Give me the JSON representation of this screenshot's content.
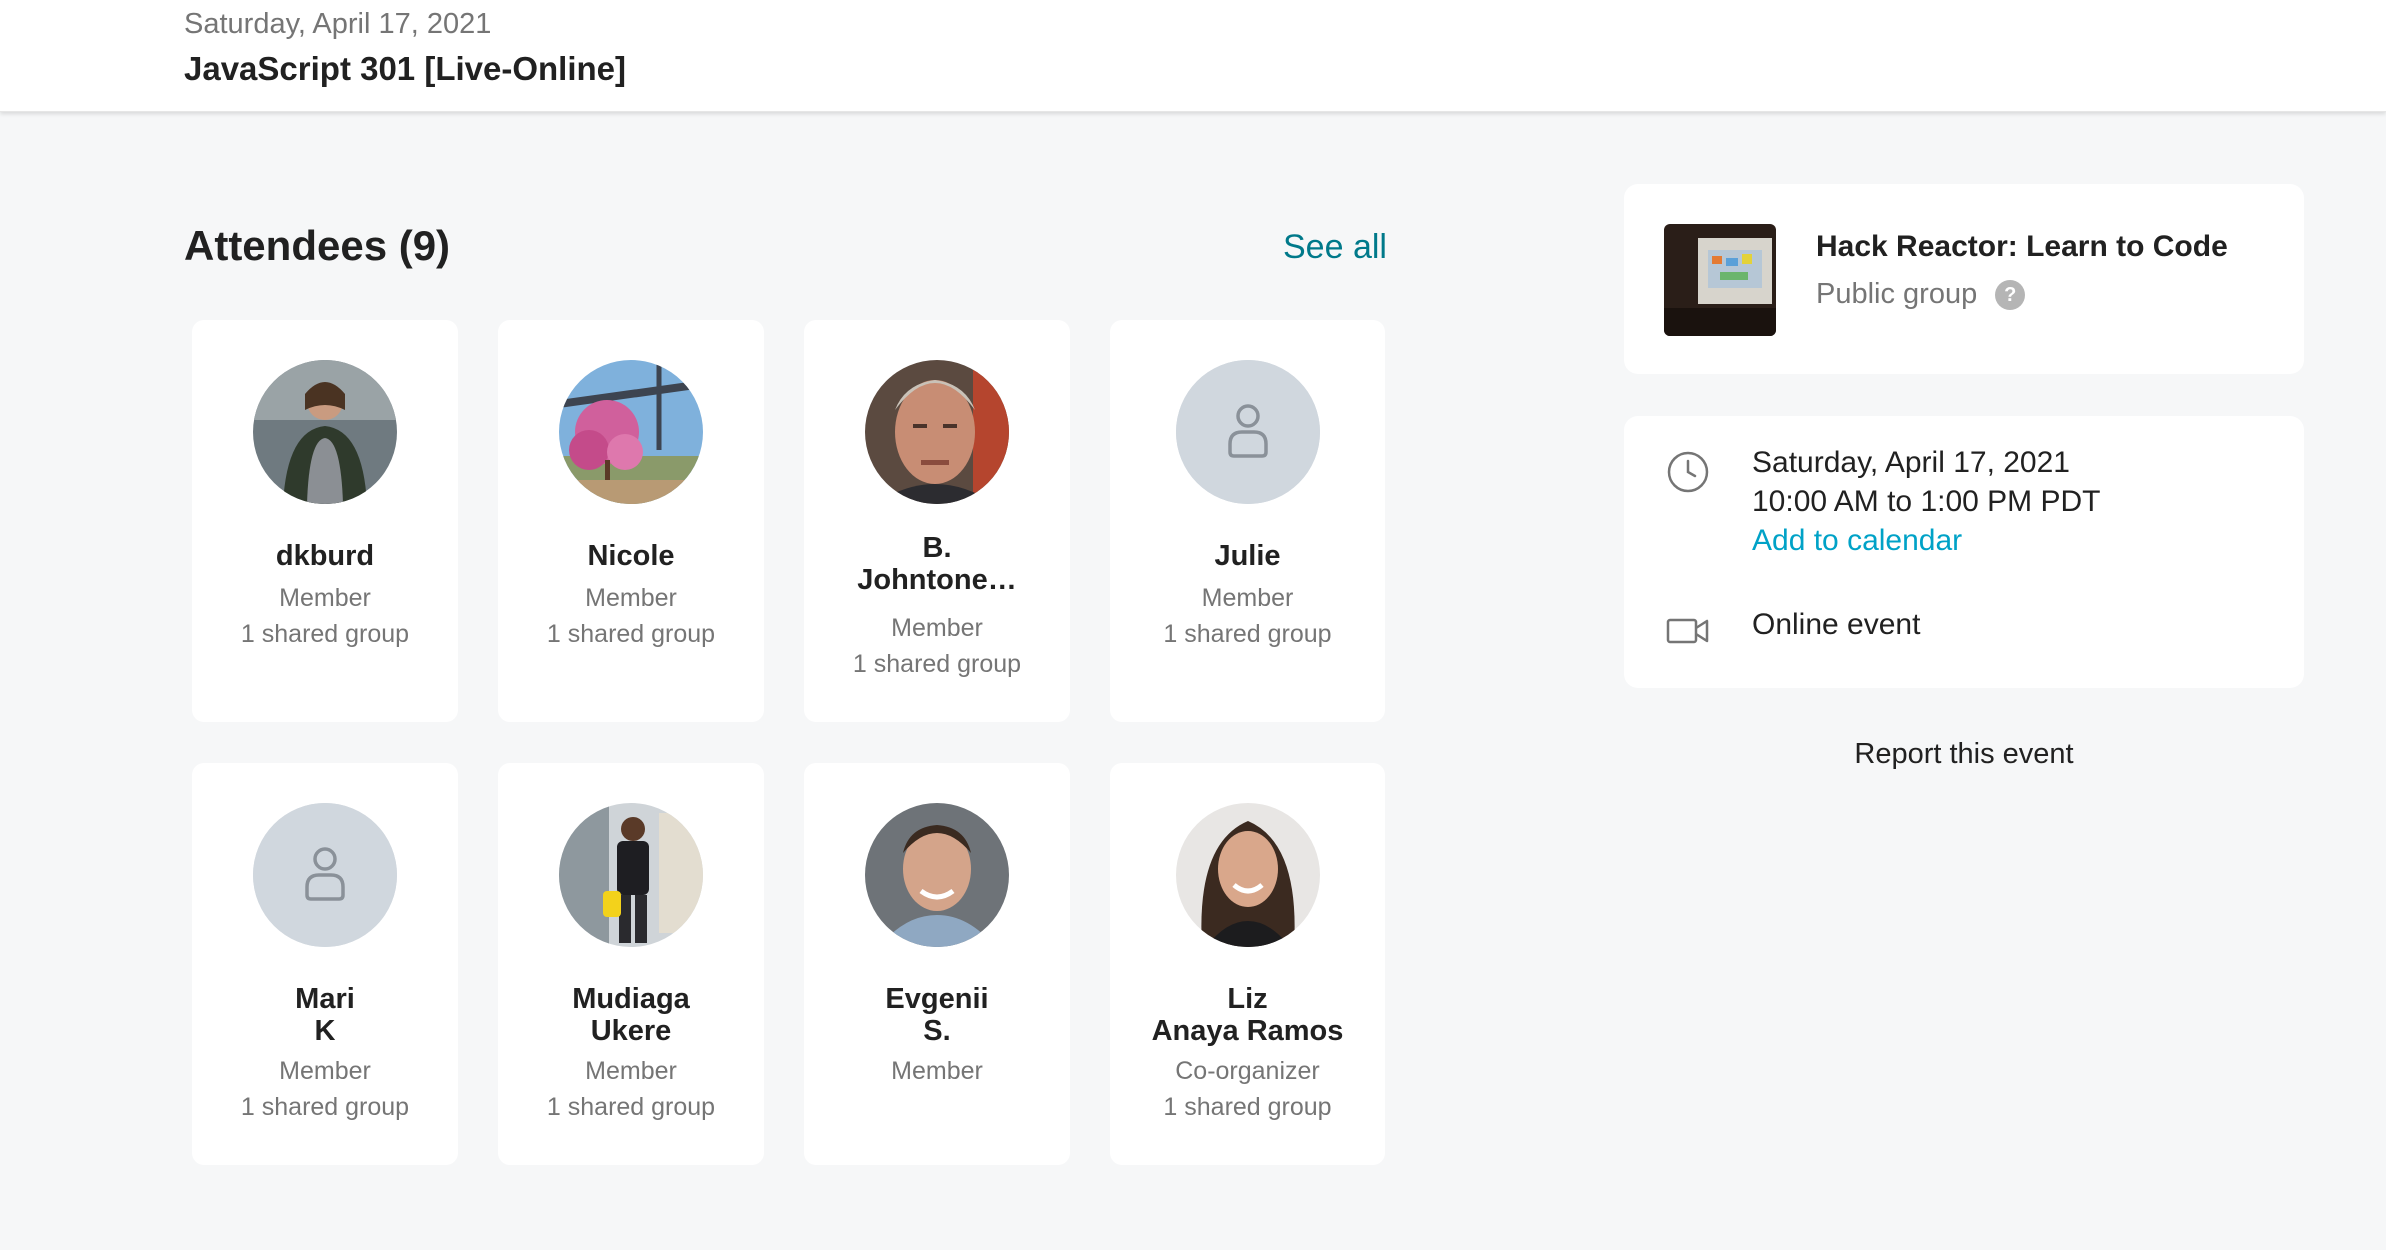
{
  "header": {
    "date": "Saturday, April 17, 2021",
    "title": "JavaScript 301 [Live-Online]"
  },
  "attendees": {
    "heading": "Attendees (9)",
    "see_all": "See all",
    "people": [
      {
        "name": "dkburd",
        "role": "Member",
        "shared": "1 shared group",
        "avatar": "photo-woman-icon"
      },
      {
        "name": "Nicole",
        "role": "Member",
        "shared": "1 shared group",
        "avatar": "photo-blossom-bridge"
      },
      {
        "name": "B.\nJohntone…",
        "role": "Member",
        "shared": "1 shared group",
        "avatar": "photo-man-icon"
      },
      {
        "name": "Julie",
        "role": "Member",
        "shared": "1 shared group",
        "avatar": "default-user-icon"
      },
      {
        "name": "Mari\nK",
        "role": "Member",
        "shared": "1 shared group",
        "avatar": "default-user-icon"
      },
      {
        "name": "Mudiaga\nUkere",
        "role": "Member",
        "shared": "1 shared group",
        "avatar": "photo-street-person"
      },
      {
        "name": "Evgenii\nS.",
        "role": "Member",
        "shared": "",
        "avatar": "photo-man-smiling"
      },
      {
        "name": "Liz\nAnaya Ramos",
        "role": "Co-organizer",
        "shared": "1 shared group",
        "avatar": "photo-woman-smiling"
      }
    ]
  },
  "group": {
    "name": "Hack Reactor: Learn to Code",
    "type": "Public group",
    "help": "?"
  },
  "event": {
    "date": "Saturday, April 17, 2021",
    "time": "10:00 AM to 1:00 PM PDT",
    "add_to_calendar": "Add to calendar",
    "location": "Online event"
  },
  "report": "Report this event",
  "colors": {
    "accent_link": "#00798a",
    "calendar_link": "#00a2c7",
    "background": "#f6f7f8"
  }
}
